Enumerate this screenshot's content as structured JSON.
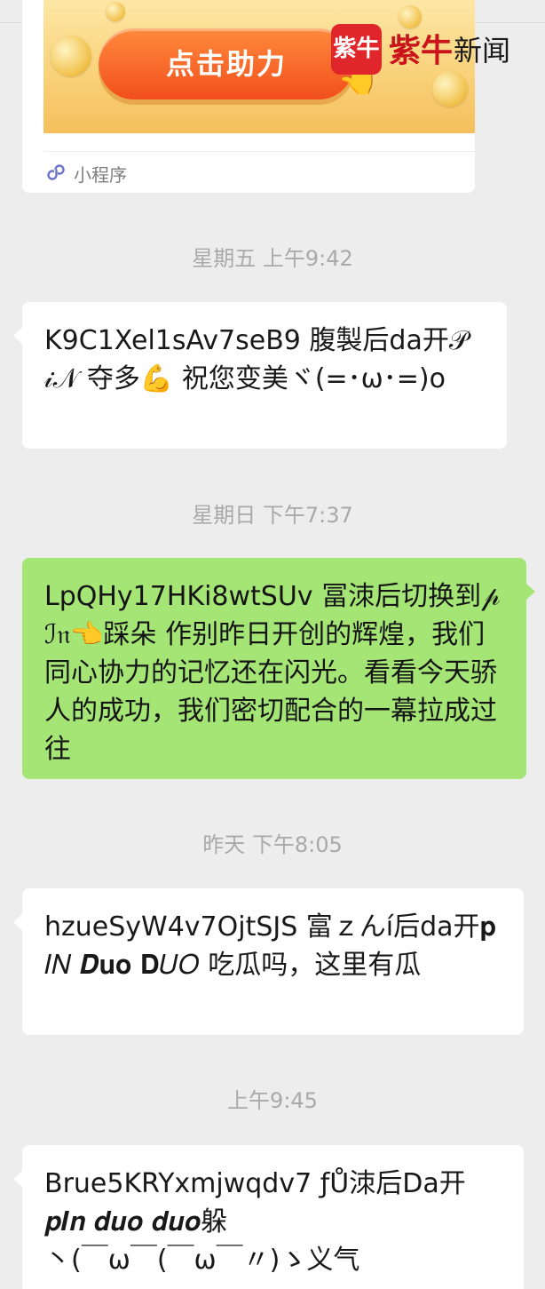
{
  "card": {
    "button_label": "点击助力",
    "footer_label": "小程序",
    "icon": "mini-program-icon"
  },
  "watermark": {
    "badge": "紫牛",
    "brand": "紫牛",
    "suffix": "新闻"
  },
  "chat": [
    {
      "type": "time",
      "text": "星期五 上午9:42"
    },
    {
      "type": "message",
      "side": "incoming",
      "text": "K9C1Xel1sAv7seB9  腹製后da开𝒫𝒾𝒩 夺多💪  祝您变美ヾ(=･ω･=)o"
    },
    {
      "type": "time",
      "text": "星期日 下午7:37"
    },
    {
      "type": "message",
      "side": "outgoing",
      "text": "LpQHy17HKi8wtSUv  冨洓后切换到𝓅ℐ𝔫👈踩朵  作别昨日开创的辉煌，我们同心协力的记忆还在闪光。看看今天骄人的成功，我们密切配合的一幕拉成过往"
    },
    {
      "type": "time",
      "text": "昨天 下午8:05"
    },
    {
      "type": "message",
      "side": "incoming",
      "text": "hzueSyW4v7OjtSJS  富ｚんí后da开𝐩𝐼𝑁 𝑫𝐮𝐨 𝐃𝑈𝑂  吃瓜吗，这里有瓜"
    },
    {
      "type": "time",
      "text": "上午9:45"
    },
    {
      "type": "message",
      "side": "incoming",
      "text": "Brue5KRYxmjwqdv7 ƒŮ洓后Da开\n𝒑𝑰𝒏 𝒅𝒖𝒐 𝒅𝒖𝒐躲\n丶(￣ω￣(￣ω￣〃)ゝ义气"
    }
  ],
  "colors": {
    "background": "#ededed",
    "incoming_bubble": "#ffffff",
    "outgoing_bubble": "#a5e576",
    "timestamp": "#a9a9a9",
    "watermark_red": "#c8141a"
  }
}
